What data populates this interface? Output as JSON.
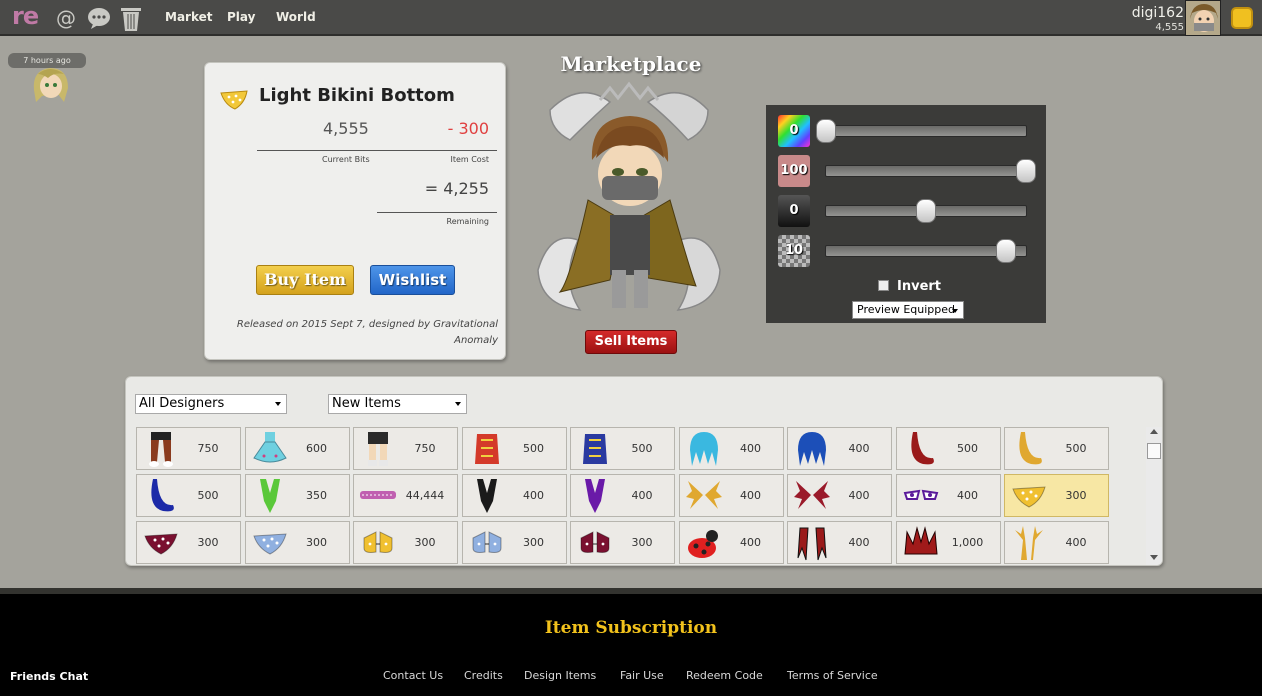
{
  "nav": {
    "logo": "re",
    "links": [
      "Market",
      "Play",
      "World"
    ]
  },
  "user": {
    "name": "digi162",
    "bits": "4,555"
  },
  "notification": {
    "time": "7 hours ago"
  },
  "item": {
    "name": "Light Bikini Bottom",
    "current_bits": "4,555",
    "cost": "- 300",
    "current_label": "Current Bits",
    "cost_label": "Item Cost",
    "remaining": "= 4,255",
    "remaining_label": "Remaining",
    "buy_label": "Buy Item",
    "wishlist_label": "Wishlist",
    "released": "Released on 2015 Sept 7, designed by Gravitational Anomaly"
  },
  "marketplace": {
    "title": "Marketplace",
    "sell_label": "Sell Items"
  },
  "color_panel": {
    "hue": "0",
    "saturation": "100",
    "brightness": "0",
    "contrast": "10",
    "hue_level": 0.0,
    "saturation_level": 1.0,
    "brightness_level": 0.5,
    "contrast_level": 0.9,
    "invert_label": "Invert",
    "preview_select": "Preview Equipped"
  },
  "browser": {
    "designer_filter": "All Designers",
    "sort_filter": "New Items",
    "items": [
      {
        "price": "750",
        "icon": "pants-shoes-icon",
        "color": "#8a3b1e"
      },
      {
        "price": "600",
        "icon": "dress-icon",
        "color": "#6fd0e0"
      },
      {
        "price": "750",
        "icon": "shorts-boots-icon",
        "color": "#2a2a2a"
      },
      {
        "price": "500",
        "icon": "top-icon",
        "color": "#d43a2a"
      },
      {
        "price": "500",
        "icon": "top-icon",
        "color": "#2a3aa0"
      },
      {
        "price": "400",
        "icon": "hair-icon",
        "color": "#3ab8e0"
      },
      {
        "price": "400",
        "icon": "hair-icon",
        "color": "#1c4fb8"
      },
      {
        "price": "500",
        "icon": "tail-icon",
        "color": "#9a1a1a"
      },
      {
        "price": "500",
        "icon": "tail-icon",
        "color": "#e0a830"
      },
      {
        "price": "500",
        "icon": "tail-icon",
        "color": "#1c2aa8"
      },
      {
        "price": "350",
        "icon": "bodysuit-icon",
        "color": "#5ac83a"
      },
      {
        "price": "44,444",
        "icon": "bracelet-icon",
        "color": "#c060b0"
      },
      {
        "price": "400",
        "icon": "bodysuit-icon",
        "color": "#1a1a1a"
      },
      {
        "price": "400",
        "icon": "bodysuit-icon",
        "color": "#6a1aa8"
      },
      {
        "price": "400",
        "icon": "wings-icon",
        "color": "#e0a830"
      },
      {
        "price": "400",
        "icon": "wings-icon",
        "color": "#9a1a2a"
      },
      {
        "price": "400",
        "icon": "eyes-icon",
        "color": "#5a1a9a"
      },
      {
        "price": "300",
        "icon": "bikini-bottom-icon",
        "color": "#f0c030",
        "selected": true
      },
      {
        "price": "300",
        "icon": "bikini-bottom-icon",
        "color": "#7a1030"
      },
      {
        "price": "300",
        "icon": "bikini-bottom-icon",
        "color": "#90b0e0"
      },
      {
        "price": "300",
        "icon": "bikini-top-icon",
        "color": "#f0c030"
      },
      {
        "price": "300",
        "icon": "bikini-top-icon",
        "color": "#90b0e0"
      },
      {
        "price": "300",
        "icon": "bikini-top-icon",
        "color": "#7a1030"
      },
      {
        "price": "400",
        "icon": "ladybug-icon",
        "color": "#e02020"
      },
      {
        "price": "400",
        "icon": "claws-icon",
        "color": "#9a1a1a"
      },
      {
        "price": "1,000",
        "icon": "crown-icon",
        "color": "#a01a1a"
      },
      {
        "price": "400",
        "icon": "antlers-icon",
        "color": "#e0a830"
      }
    ]
  },
  "footer": {
    "subscription": "Item Subscription",
    "friends_chat": "Friends Chat",
    "links": [
      "Contact Us",
      "Credits",
      "Design Items",
      "Fair Use",
      "Redeem Code",
      "Terms of Service"
    ]
  }
}
